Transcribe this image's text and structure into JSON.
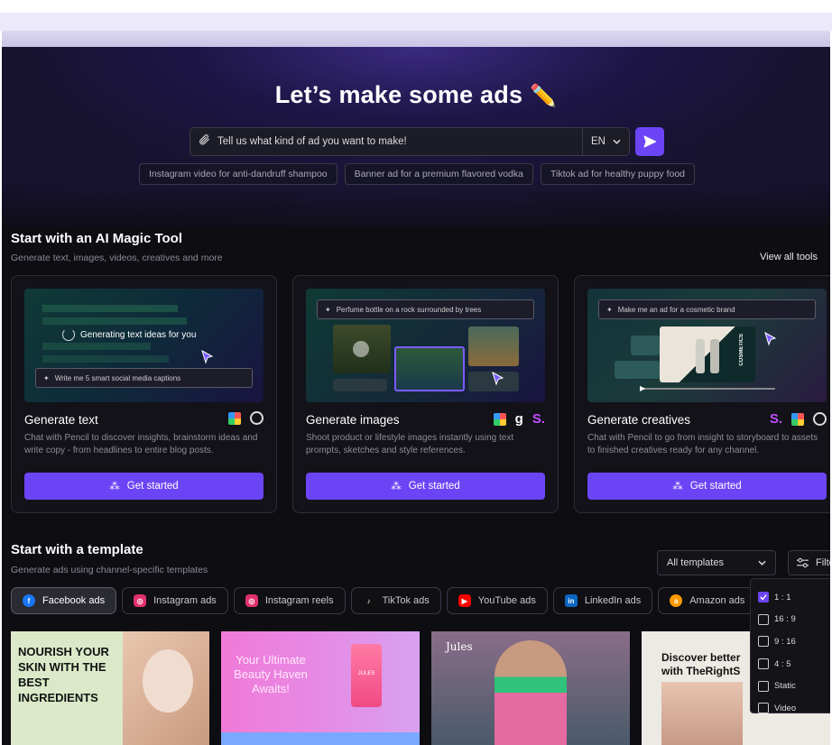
{
  "hero": {
    "title": "Let’s make some ads",
    "title_emoji": "✏️",
    "search_placeholder": "Tell us what kind of ad you want to make!",
    "language": "EN",
    "suggestions": [
      "Instagram video for anti-dandruff shampoo",
      "Banner ad for a premium flavored vodka",
      "Tiktok ad for healthy puppy food"
    ]
  },
  "tools_section": {
    "title": "Start with an AI Magic Tool",
    "subtitle": "Generate text, images, videos, creatives and more",
    "view_all": "View all tools",
    "cards": [
      {
        "title": "Generate text",
        "description": "Chat with Pencil to discover insights, brainstorm ideas and write copy - from headlines to entire blog posts.",
        "button": "Get started",
        "preview_status": "Generating text ideas for you",
        "preview_prompt": "Write me 5 smart social media captions"
      },
      {
        "title": "Generate images",
        "description": "Shoot product or lifestyle images instantly using text prompts, sketches and style references.",
        "button": "Get started",
        "preview_prompt": "Perfume bottle on a rock surrounded by trees"
      },
      {
        "title": "Generate creatives",
        "description": "Chat with Pencil to go from insight to storyboard to assets to finished creatives ready for any channel.",
        "button": "Get started",
        "preview_prompt": "Make me an ad for a cosmetic brand",
        "preview_label": "COSMETICS"
      }
    ]
  },
  "templates_section": {
    "title": "Start with a template",
    "subtitle": "Generate ads using channel-specific templates",
    "dropdown_value": "All templates",
    "filter_label": "Filte",
    "tabs": [
      {
        "label": "Facebook ads",
        "color": "#1877f2",
        "glyph": "f",
        "active": true
      },
      {
        "label": "Instagram ads",
        "color": "#e1306c",
        "glyph": "◎",
        "active": false
      },
      {
        "label": "Instagram reels",
        "color": "#e1306c",
        "glyph": "◎",
        "active": false
      },
      {
        "label": "TikTok ads",
        "color": "#111111",
        "glyph": "♪",
        "active": false
      },
      {
        "label": "YouTube ads",
        "color": "#ff0000",
        "glyph": "▶",
        "active": false
      },
      {
        "label": "LinkedIn ads",
        "color": "#0a66c2",
        "glyph": "in",
        "active": false
      },
      {
        "label": "Amazon ads",
        "color": "#ff9900",
        "glyph": "a",
        "active": false
      }
    ],
    "filter_options": [
      {
        "label": "1 : 1",
        "checked": true
      },
      {
        "label": "16 : 9",
        "checked": false
      },
      {
        "label": "9 : 16",
        "checked": false
      },
      {
        "label": "4 : 5",
        "checked": false
      },
      {
        "label": "Static",
        "checked": false
      },
      {
        "label": "Video",
        "checked": false
      }
    ],
    "thumbnails": [
      {
        "text": "NOURISH YOUR SKIN WITH THE BEST INGREDIENTS"
      },
      {
        "text": "Your Ultimate Beauty Haven Awaits!",
        "brand": "JULES"
      },
      {
        "brand": "Jules"
      },
      {
        "text": "Discover better with TheRightS"
      }
    ]
  }
}
